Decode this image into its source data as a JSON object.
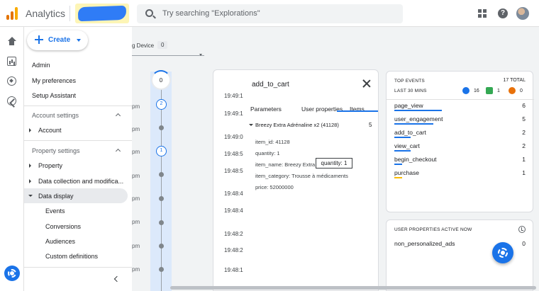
{
  "header": {
    "app_title": "Analytics",
    "search_placeholder": "Try searching \"Explorations\"",
    "help_glyph": "?",
    "logo_colors": [
      "#f9ab00",
      "#e37400",
      "#e37400"
    ]
  },
  "menu": {
    "create_label": "Create",
    "admin": "Admin",
    "my_preferences": "My preferences",
    "setup_assistant": "Setup Assistant",
    "account_settings": "Account settings",
    "account": "Account",
    "property_settings": "Property settings",
    "property": "Property",
    "data_collection": "Data collection and modifica...",
    "data_display": "Data display",
    "sub_items": [
      "Events",
      "Conversions",
      "Audiences",
      "Custom definitions"
    ]
  },
  "device": {
    "label": "g Device",
    "count": "0"
  },
  "timeline": {
    "top_count": "0",
    "node_counts": [
      "2",
      "1"
    ],
    "time_labels": [
      "pm",
      "pm",
      "pm",
      "pm",
      "pm",
      "pm",
      "pm",
      "pm",
      "pm",
      "pm"
    ]
  },
  "event_card": {
    "title": "add_to_cart",
    "tabs": [
      "Parameters",
      "User properties",
      "Items"
    ],
    "times": [
      "19:49:1",
      "19:49:1",
      "19:49:0",
      "19:48:5",
      "19:48:5",
      "19:48:4",
      "19:48:4",
      "19:48:2",
      "19:48:2",
      "19:48:1"
    ],
    "item_header": "Breezy Extra Adrénaline x2 (41128)",
    "item_count": "5",
    "params": [
      "item_id: 41128",
      "quantity: 1",
      "item_name: Breezy Extra",
      "item_category: Trousse à médicaments",
      "price: 52000000"
    ],
    "tooltip": "quantity: 1"
  },
  "top_events": {
    "title": "TOP EVENTS",
    "total": "17 TOTAL",
    "subtitle": "LAST 30 MINS",
    "badges": [
      {
        "value": "16",
        "color": "#1a73e8"
      },
      {
        "value": "1",
        "color": "#34a853"
      },
      {
        "value": "0",
        "color": "#e8710a"
      }
    ],
    "events": [
      {
        "name": "page_view",
        "count": "6",
        "share": 0.35
      },
      {
        "name": "user_engagement",
        "count": "5",
        "share": 0.29
      },
      {
        "name": "add_to_cart",
        "count": "2",
        "share": 0.12
      },
      {
        "name": "view_cart",
        "count": "2",
        "share": 0.12
      },
      {
        "name": "begin_checkout",
        "count": "1",
        "share": 0.06
      },
      {
        "name": "purchase",
        "count": "1",
        "share": 0.06
      }
    ]
  },
  "user_properties": {
    "title": "USER PROPERTIES ACTIVE NOW",
    "rows": [
      {
        "name": "non_personalized_ads",
        "count": "0"
      }
    ]
  }
}
